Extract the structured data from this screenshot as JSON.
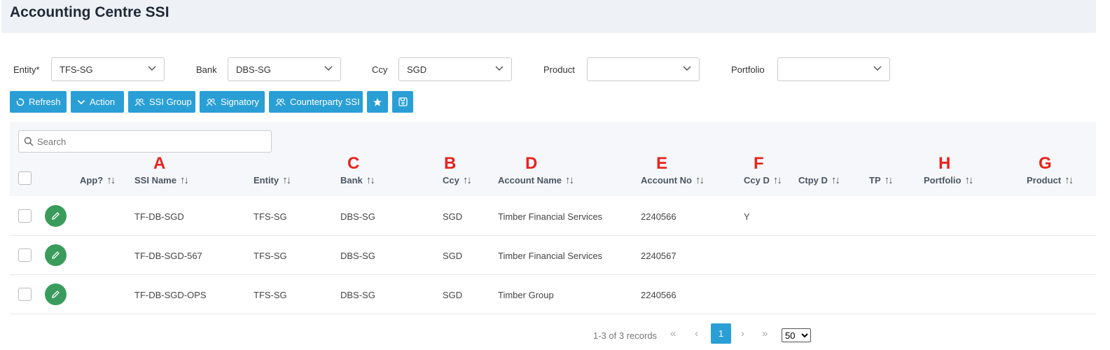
{
  "page": {
    "title": "Accounting Centre SSI"
  },
  "filters": [
    {
      "label": "Entity*",
      "value": "TFS-SG"
    },
    {
      "label": "Bank",
      "value": "DBS-SG"
    },
    {
      "label": "Ccy",
      "value": "SGD"
    },
    {
      "label": "Product",
      "value": ""
    },
    {
      "label": "Portfolio",
      "value": ""
    }
  ],
  "toolbar": {
    "refresh": "Refresh",
    "action": "Action",
    "ssi_group": "SSI Group",
    "signatory": "Signatory",
    "counterparty_ssi": "Counterparty SSI"
  },
  "search": {
    "placeholder": "Search",
    "value": ""
  },
  "columns": {
    "app": "App?",
    "ssi_name": "SSI Name",
    "entity": "Entity",
    "bank": "Bank",
    "ccy": "Ccy",
    "account_name": "Account Name",
    "account_no": "Account No",
    "ccy_d": "Ccy D",
    "ctpy_d": "Ctpy D",
    "tp": "TP",
    "portfolio": "Portfolio",
    "product": "Product"
  },
  "markers": {
    "ssi_name": "A",
    "bank": "C",
    "ccy": "B",
    "account_name": "D",
    "account_no": "E",
    "ccy_d": "F",
    "portfolio": "H",
    "product": "G"
  },
  "rows": [
    {
      "ssi_name": "TF-DB-SGD",
      "entity": "TFS-SG",
      "bank": "DBS-SG",
      "ccy": "SGD",
      "account_name": "Timber Financial Services",
      "account_no": "2240566",
      "ccy_d": "Y"
    },
    {
      "ssi_name": "TF-DB-SGD-567",
      "entity": "TFS-SG",
      "bank": "DBS-SG",
      "ccy": "SGD",
      "account_name": "Timber Financial Services",
      "account_no": "2240567",
      "ccy_d": ""
    },
    {
      "ssi_name": "TF-DB-SGD-OPS",
      "entity": "TFS-SG",
      "bank": "DBS-SG",
      "ccy": "SGD",
      "account_name": "Timber Group",
      "account_no": "2240566",
      "ccy_d": ""
    }
  ],
  "paginator": {
    "info": "1-3 of 3 records",
    "first": "«",
    "prev": "‹",
    "current_page": "1",
    "next": "›",
    "last": "»",
    "page_size": "50"
  },
  "colors": {
    "accent": "#2a9fd6",
    "edit": "#3a9c5c",
    "marker": "#e8231c",
    "header_bg": "#eef1f5"
  }
}
